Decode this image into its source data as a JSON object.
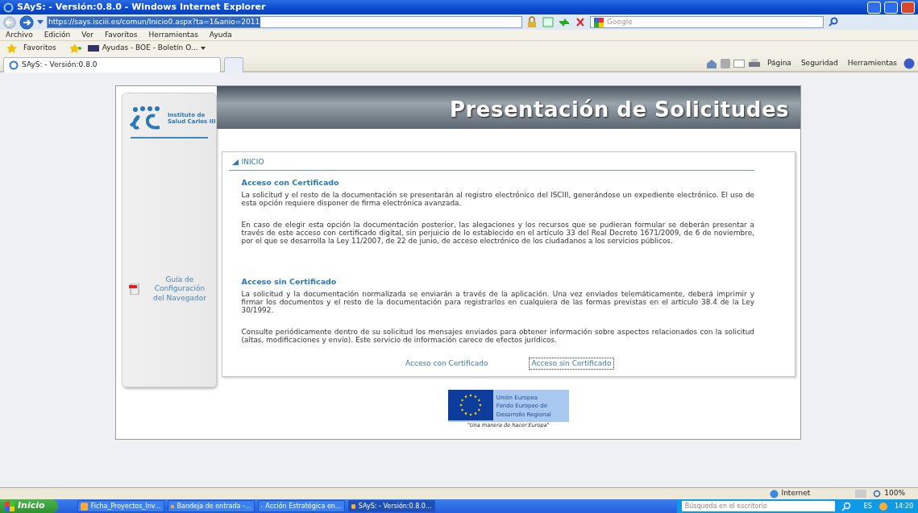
{
  "window": {
    "title": "SAyS: - Versión:0.8.0 - Windows Internet Explorer"
  },
  "address_bar": {
    "url": "https://says.isciii.es/comun/Inicio0.aspx?ta=1&anio=2011",
    "search_placeholder": "Google"
  },
  "menu": [
    "Archivo",
    "Edición",
    "Ver",
    "Favoritos",
    "Herramientas",
    "Ayuda"
  ],
  "favorites_bar": {
    "label": "Favoritos",
    "links": [
      "Ayudas - BOE - Boletín O..."
    ]
  },
  "tabs": [
    {
      "kind": "page",
      "label": "SAyS: - Versión:0.8.0",
      "selected": true
    },
    {
      "kind": "new_tab",
      "selected": false
    }
  ],
  "command_bar": [
    "Página",
    "Seguridad",
    "Herramientas"
  ],
  "page": {
    "logo": {
      "lines": [
        "Instituto de",
        "Salud Carlos III"
      ]
    },
    "sidebar_link": {
      "lines": [
        "Guía de",
        "Configuración",
        "del Navegador"
      ]
    },
    "banner_title": "Presentación de Solicitudes",
    "section_title": "INICIO",
    "sections": [
      {
        "heading": "Acceso con Certificado",
        "paragraphs": [
          "La solicitud y el resto de la documentación se presentarán al registro electrónico del ISCIII, generándose un expediente electrónico. El uso de esta opción requiere disponer de firma electrónica avanzada.",
          "En caso de elegir esta opción la documentación posterior, las alegaciones y los recursos que se pudieran formular se deberán presentar a través de este acceso con certificado digital, sin perjuicio de lo establecido en el artículo 33 del Real Decreto 1671/2009, de 6 de noviembre, por el que se desarrolla la Ley 11/2007, de 22 de junio, de acceso electrónico de los ciudadanos a los servicios públicos."
        ]
      },
      {
        "heading": "Acceso sin Certificado",
        "paragraphs": [
          "La solicitud y la documentación normalizada se enviarán a través de la aplicación. Una vez enviados telemáticamente, deberá imprimir y firmar los documentos y el resto de la documentación para registrarlos en cualquiera de las formas previstas en el artículo 38.4 de la Ley 30/1992.",
          "Consulte periódicamente dentro de su solicitud los mensajes enviados para obtener información sobre aspectos relacionados con la solicitud (altas, modificaciones y envío). Este servicio de información carece de efectos jurídicos."
        ]
      }
    ],
    "links": [
      {
        "label": "Acceso con Certificado",
        "focused": false
      },
      {
        "label": "Acceso sin Certificado",
        "focused": true
      }
    ],
    "eu_logo": {
      "title": "Unión Europea",
      "fund_lines": [
        "Fondo Europeo de",
        "Desarrollo Regional"
      ],
      "slogan": "\"Una manera de hacer Europa\""
    }
  },
  "status_bar": {
    "zone": "Internet",
    "zoom": "100%"
  },
  "taskbar": {
    "start": "Inicio",
    "tasks": [
      {
        "label": "Ficha_Proyectos_Inv...",
        "selected": false
      },
      {
        "label": "Bandeja de entrada -...",
        "selected": false
      },
      {
        "label": "Acción Estratégica en...",
        "selected": false
      },
      {
        "label": "SAyS: - Versión:0.8.0...",
        "selected": true
      }
    ],
    "search_placeholder": "Búsqueda en el escritorio",
    "language": "ES",
    "clock": "14:20"
  }
}
